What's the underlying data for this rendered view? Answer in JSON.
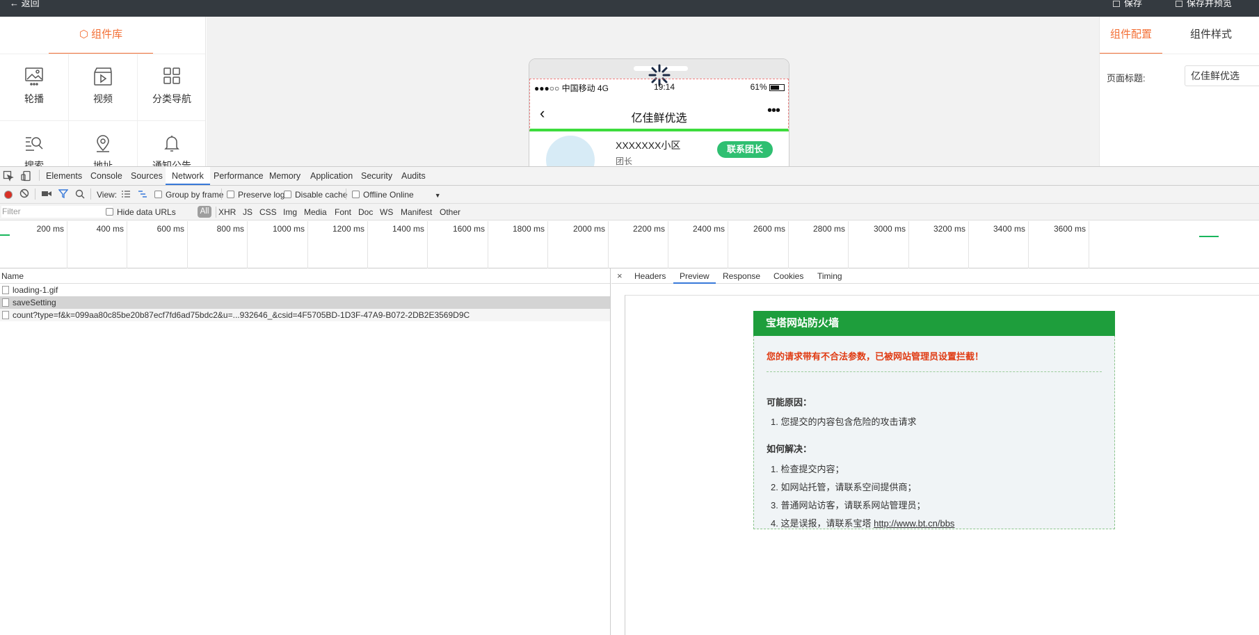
{
  "topbar": {
    "back": "返回",
    "save": "保存",
    "save_preview": "保存并预览"
  },
  "left_panel": {
    "tab": "组件库",
    "components": [
      {
        "label": "轮播",
        "icon": "image-carousel-icon"
      },
      {
        "label": "视频",
        "icon": "video-icon"
      },
      {
        "label": "分类导航",
        "icon": "grid-icon"
      },
      {
        "label": "搜索",
        "icon": "search-list-icon"
      },
      {
        "label": "地址",
        "icon": "location-pin-icon"
      },
      {
        "label": "通知公告",
        "icon": "bell-icon"
      }
    ]
  },
  "phone": {
    "carrier": "●●●○○ 中国移动   4G",
    "time": "19:14",
    "battery": "61%",
    "nav_title": "亿佳鲜优选",
    "nav_more": "•••",
    "community": "XXXXXXX小区",
    "leader_sub": "团长",
    "contact_button": "联系团长"
  },
  "right_panel": {
    "tabs": [
      "组件配置",
      "组件样式"
    ],
    "page_title_label": "页面标题:",
    "page_title_value": "亿佳鲜优选"
  },
  "devtools": {
    "tabs": [
      "Elements",
      "Console",
      "Sources",
      "Network",
      "Performance",
      "Memory",
      "Application",
      "Security",
      "Audits"
    ],
    "active_tab": "Network",
    "toolbar": {
      "view_label": "View:",
      "group_by_frame": "Group by frame",
      "preserve_log": "Preserve log",
      "disable_cache": "Disable cache",
      "offline": "Offline",
      "throttle": "Online"
    },
    "filter": {
      "placeholder": "Filter",
      "hide_data_urls": "Hide data URLs",
      "types": [
        "All",
        "XHR",
        "JS",
        "CSS",
        "Img",
        "Media",
        "Font",
        "Doc",
        "WS",
        "Manifest",
        "Other"
      ]
    },
    "timeline_labels": [
      "200 ms",
      "400 ms",
      "600 ms",
      "800 ms",
      "1000 ms",
      "1200 ms",
      "1400 ms",
      "1600 ms",
      "1800 ms",
      "2000 ms",
      "2200 ms",
      "2400 ms",
      "2600 ms",
      "2800 ms",
      "3000 ms",
      "3200 ms",
      "3400 ms",
      "3600 ms"
    ],
    "requests": {
      "header": "Name",
      "rows": [
        "loading-1.gif",
        "saveSetting",
        "count?type=f&k=099aa80c85be20b87ecf7fd6ad75bdc2&u=...932646_&csid=4F5705BD-1D3F-47A9-B072-2DB2E3569D9C"
      ],
      "selected_index": 1
    },
    "detail": {
      "close": "×",
      "tabs": [
        "Headers",
        "Preview",
        "Response",
        "Cookies",
        "Timing"
      ],
      "active_tab": "Preview"
    }
  },
  "firewall": {
    "title": "宝塔网站防火墙",
    "alert": "您的请求带有不合法参数，已被网站管理员设置拦截！",
    "reasons_heading": "可能原因：",
    "reasons": [
      "1. 您提交的内容包含危险的攻击请求"
    ],
    "solutions_heading": "如何解决：",
    "solutions": [
      "1. 检查提交内容；",
      "2. 如网站托管，请联系空间提供商；",
      "3. 普通网站访客，请联系网站管理员；",
      "4. 这是误报，请联系宝塔"
    ],
    "link": "http://www.bt.cn/bbs"
  },
  "colors": {
    "accent": "#f36f35",
    "firewall_green": "#1e9e3c",
    "alert_red": "#e03b13",
    "devtools_blue": "#3879d9"
  }
}
